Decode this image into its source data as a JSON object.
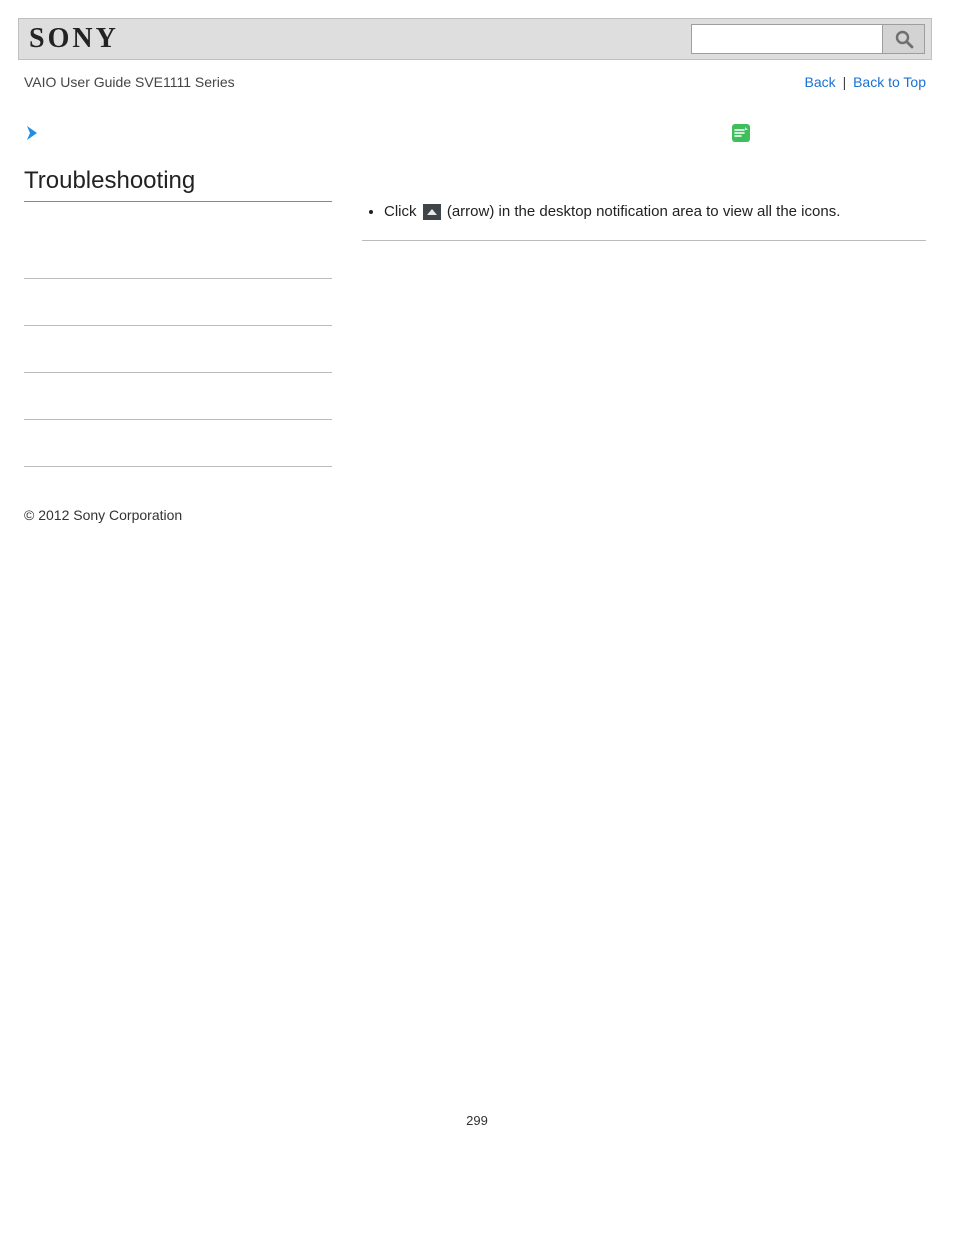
{
  "header": {
    "logo_text": "SONY",
    "search_placeholder": ""
  },
  "subheader": {
    "guide_title": "VAIO User Guide SVE1111 Series",
    "back_label": "Back",
    "separator": "|",
    "back_to_top_label": "Back to Top"
  },
  "sidebar": {
    "title": "Troubleshooting",
    "items": [
      "",
      "",
      "",
      "",
      ""
    ]
  },
  "main": {
    "step_prefix": "Click ",
    "step_suffix": " (arrow) in the desktop notification area to view all the icons."
  },
  "footer": {
    "copyright": "© 2012 Sony Corporation",
    "page_number": "299"
  }
}
